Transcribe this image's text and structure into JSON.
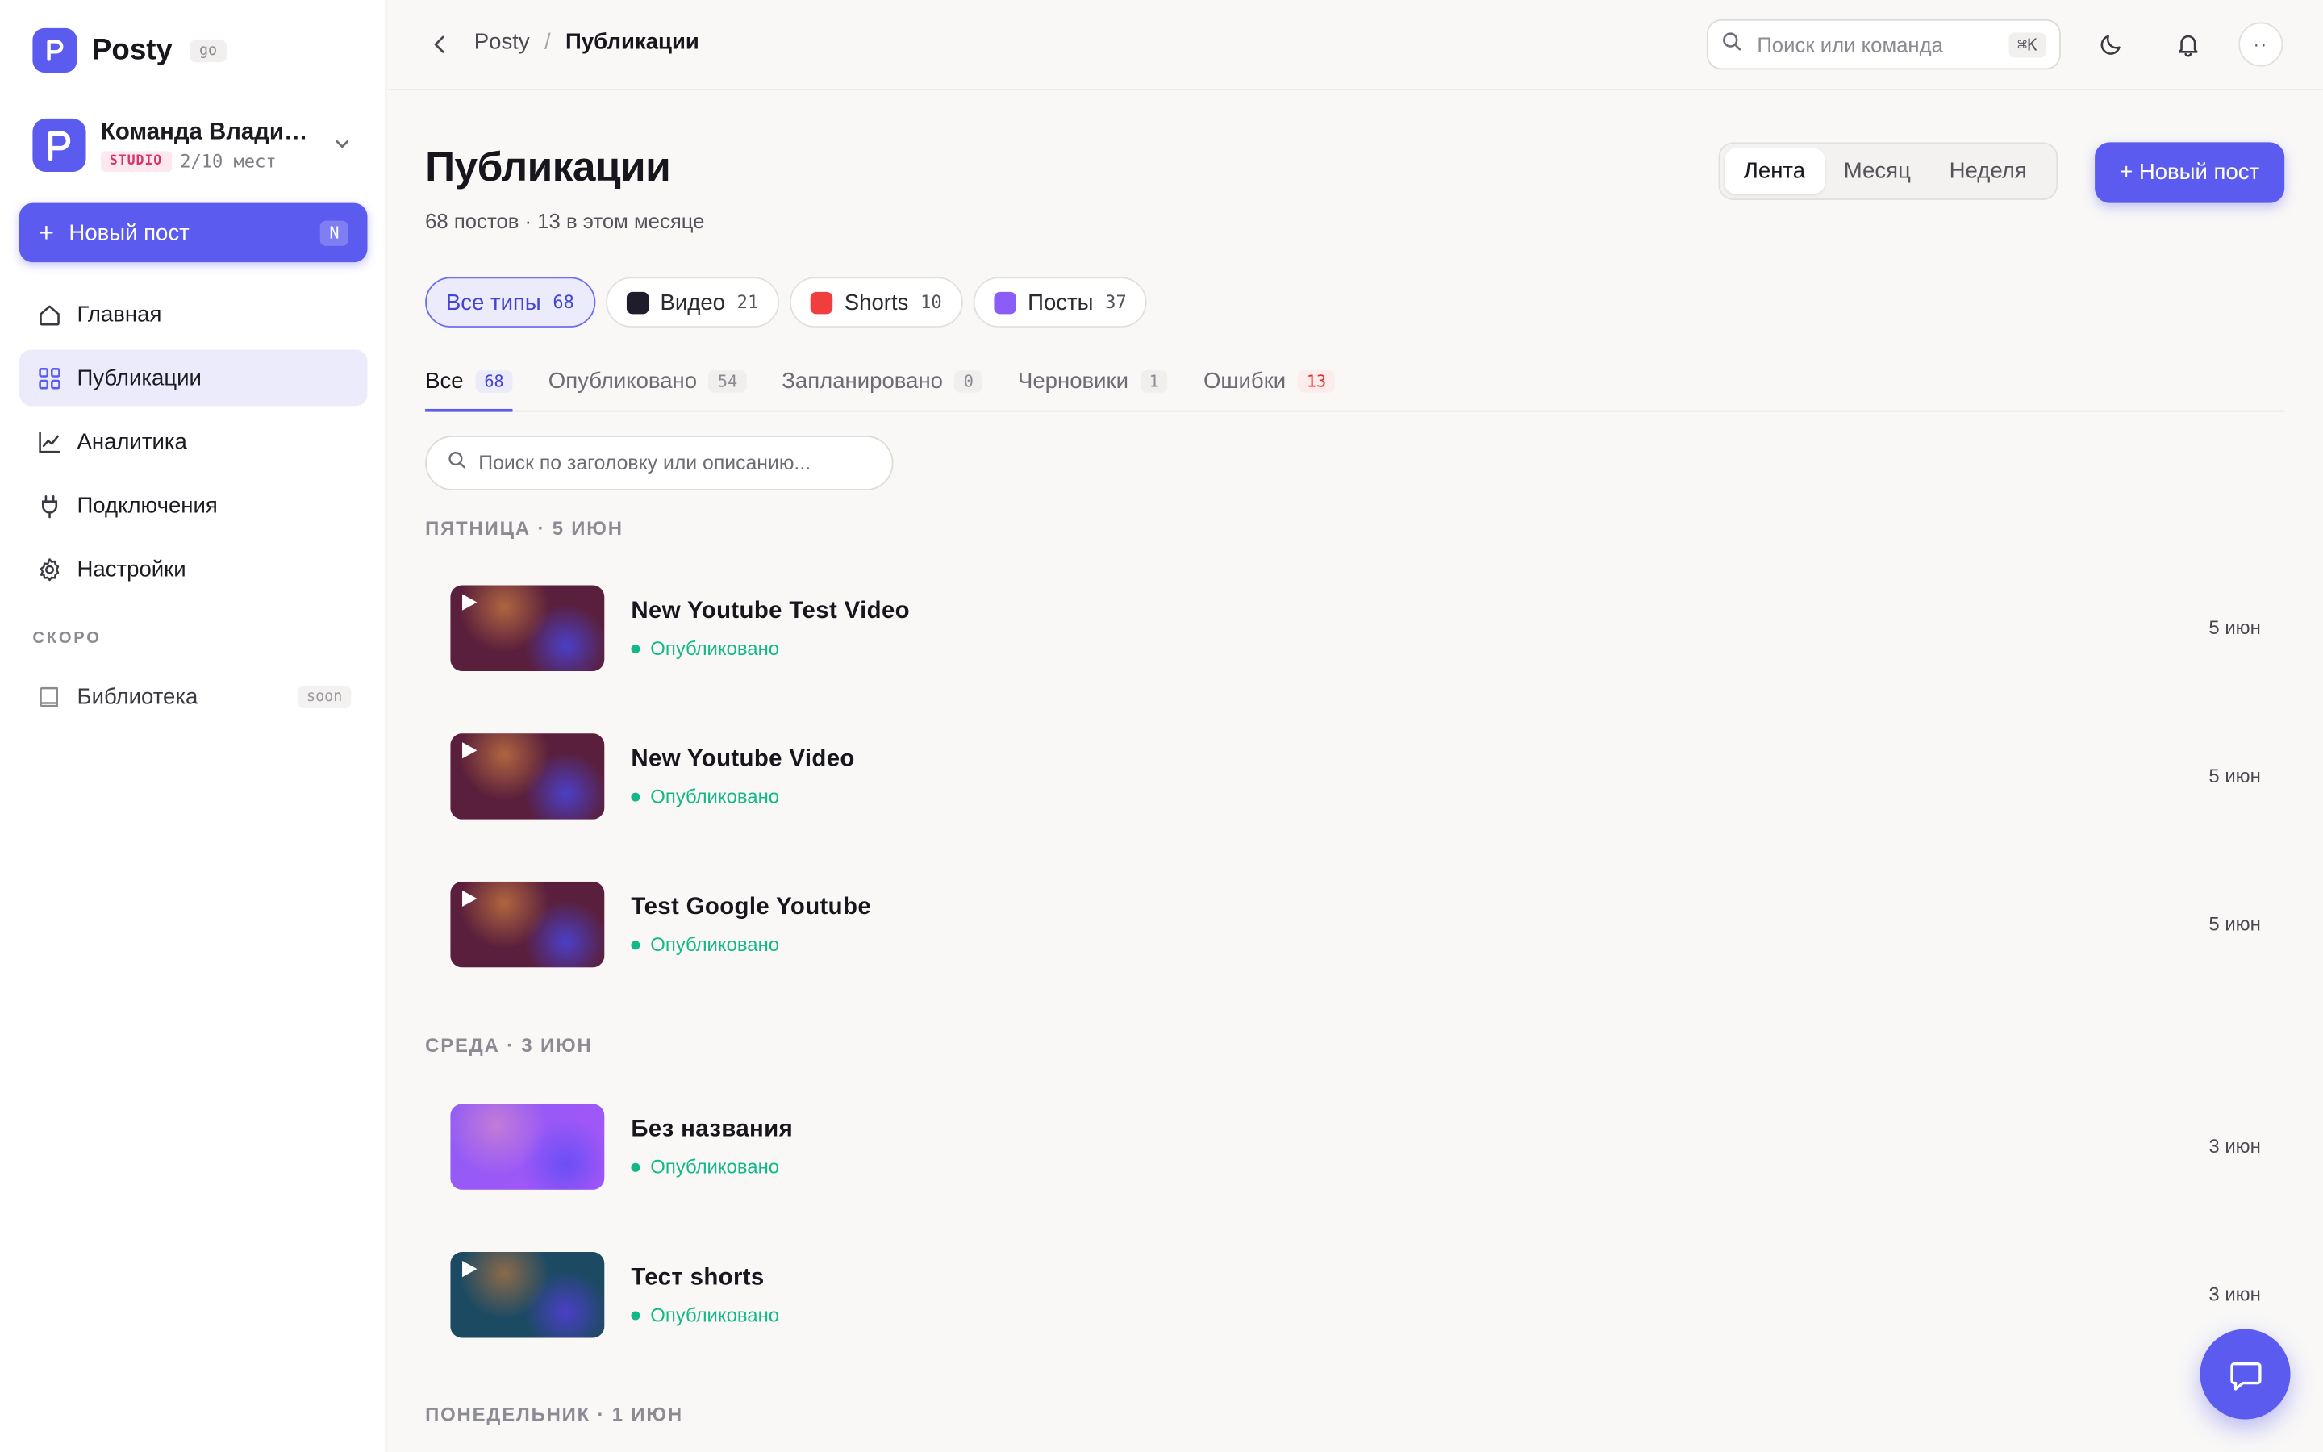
{
  "brand": {
    "name": "Posty",
    "badge": "go"
  },
  "team": {
    "name": "Команда Владимира",
    "plan_badge": "STUDIO",
    "seats": "2/10 мест"
  },
  "sidebar": {
    "new_post_label": "Новый пост",
    "new_post_shortcut": "N",
    "items": [
      {
        "label": "Главная",
        "icon": "home-icon",
        "active": false
      },
      {
        "label": "Публикации",
        "icon": "grid-icon",
        "active": true
      },
      {
        "label": "Аналитика",
        "icon": "chart-line-icon",
        "active": false
      },
      {
        "label": "Подключения",
        "icon": "plug-icon",
        "active": false
      },
      {
        "label": "Настройки",
        "icon": "gear-icon",
        "active": false
      }
    ],
    "soon_section": "СКОРО",
    "soon_items": [
      {
        "label": "Библиотека",
        "badge": "soon",
        "icon": "book-icon"
      }
    ]
  },
  "topbar": {
    "breadcrumb_root": "Posty",
    "breadcrumb_sep": "/",
    "breadcrumb_current": "Публикации",
    "search_placeholder": "Поиск или команда",
    "search_shortcut": "⌘K",
    "user_initials": "··"
  },
  "header": {
    "title": "Публикации",
    "subtitle": "68 постов · 13 в этом месяце",
    "views": [
      "Лента",
      "Месяц",
      "Неделя"
    ],
    "active_view": "Лента",
    "new_post_label": "+ Новый пост"
  },
  "type_filters": [
    {
      "label": "Все типы",
      "count": "68",
      "active": true,
      "color": ""
    },
    {
      "label": "Видео",
      "count": "21",
      "active": false,
      "color": "#1f1d2b"
    },
    {
      "label": "Shorts",
      "count": "10",
      "active": false,
      "color": "#f03e3e"
    },
    {
      "label": "Посты",
      "count": "37",
      "active": false,
      "color": "#8b5cf6"
    }
  ],
  "status_tabs": [
    {
      "label": "Все",
      "count": "68",
      "active": true
    },
    {
      "label": "Опубликовано",
      "count": "54",
      "active": false
    },
    {
      "label": "Запланировано",
      "count": "0",
      "active": false
    },
    {
      "label": "Черновики",
      "count": "1",
      "active": false
    },
    {
      "label": "Ошибки",
      "count": "13",
      "active": false,
      "error": true
    }
  ],
  "list_search_placeholder": "Поиск по заголовку или описанию...",
  "groups": [
    {
      "day": "ПЯТНИЦА · 5 ИЮН",
      "posts": [
        {
          "title": "New Youtube Test Video",
          "status": "Опубликовано",
          "date": "5 июн",
          "thumb": "video"
        },
        {
          "title": "New Youtube Video",
          "status": "Опубликовано",
          "date": "5 июн",
          "thumb": "video"
        },
        {
          "title": "Test Google Youtube",
          "status": "Опубликовано",
          "date": "5 июн",
          "thumb": "video"
        }
      ]
    },
    {
      "day": "СРЕДА · 3 ИЮН",
      "posts": [
        {
          "title": "Без названия",
          "status": "Опубликовано",
          "date": "3 июн",
          "thumb": "post"
        },
        {
          "title": "Тест shorts",
          "status": "Опубликовано",
          "date": "3 июн",
          "thumb": "shorts"
        }
      ]
    },
    {
      "day": "ПОНЕДЕЛЬНИК · 1 ИЮН",
      "posts": []
    }
  ],
  "colors": {
    "accent": "#5b5bf0",
    "success": "#12b886",
    "error": "#e03131"
  }
}
